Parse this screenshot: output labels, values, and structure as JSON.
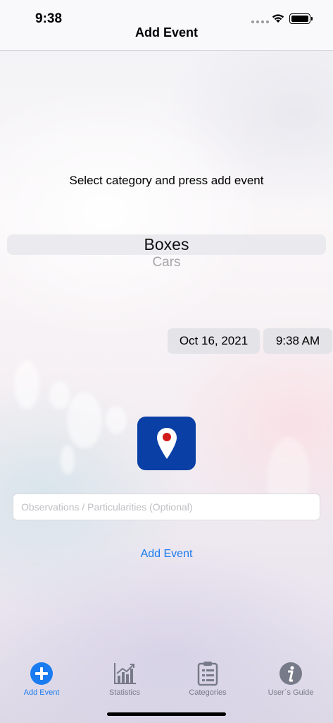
{
  "status_bar": {
    "time": "9:38"
  },
  "nav": {
    "title": "Add Event"
  },
  "instruction": "Select category and press add event",
  "category_picker": {
    "selected": "Boxes",
    "next": "Cars"
  },
  "datetime": {
    "date": "Oct 16, 2021",
    "time": "9:38 AM"
  },
  "location_button": {
    "icon": "map-pin-icon",
    "color": "#0a3fa6"
  },
  "observations": {
    "value": "",
    "placeholder": "Observations / Particularities (Optional)"
  },
  "add_event_label": "Add Event",
  "tabs": [
    {
      "label": "Add Event",
      "icon": "plus-circle-icon",
      "active": true
    },
    {
      "label": "Statistics",
      "icon": "chart-icon",
      "active": false
    },
    {
      "label": "Categories",
      "icon": "clipboard-icon",
      "active": false
    },
    {
      "label": "User´s Guide",
      "icon": "info-icon",
      "active": false
    }
  ],
  "colors": {
    "accent": "#1a7cf0",
    "tab_inactive": "#777a88"
  }
}
